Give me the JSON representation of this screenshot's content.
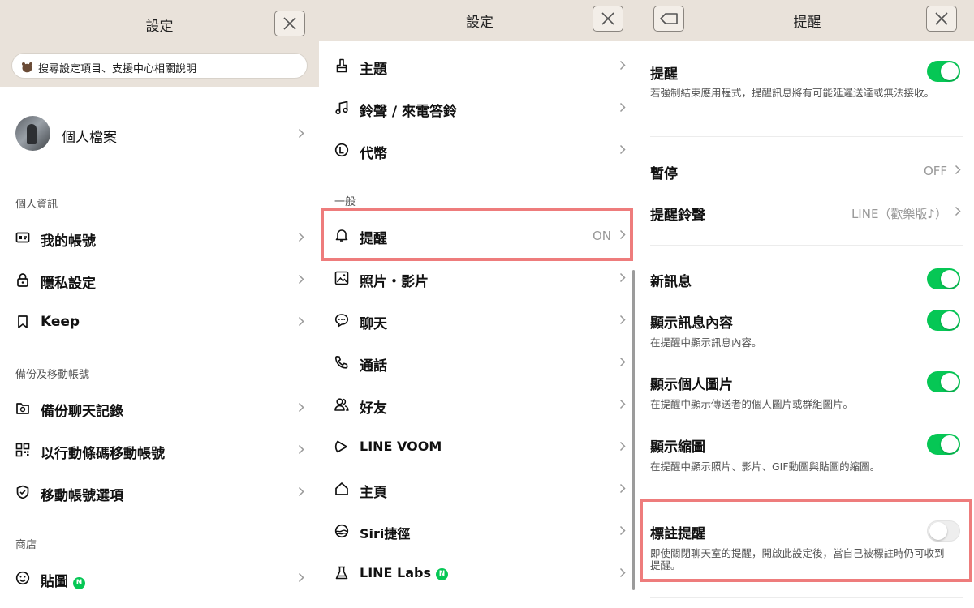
{
  "panel1": {
    "title": "設定",
    "search_placeholder": "搜尋設定項目、支援中心相關說明",
    "profile_label": "個人檔案",
    "sections": [
      {
        "header": "個人資訊",
        "items": [
          "我的帳號",
          "隱私設定",
          "Keep"
        ]
      },
      {
        "header": "備份及移動帳號",
        "items": [
          "備份聊天記錄",
          "以行動條碼移動帳號",
          "移動帳號選項"
        ]
      },
      {
        "header": "商店",
        "items": [
          "貼圖"
        ]
      }
    ],
    "new_badge": "N"
  },
  "panel2": {
    "title": "設定",
    "items_top": [
      "主題",
      "鈴聲 / 來電答鈴",
      "代幣"
    ],
    "section_header": "一般",
    "notification": {
      "label": "提醒",
      "value": "ON"
    },
    "items_bottom": [
      "照片・影片",
      "聊天",
      "通話",
      "好友",
      "LINE VOOM",
      "主頁",
      "Siri捷徑",
      "LINE Labs"
    ],
    "new_badge": "N"
  },
  "panel3": {
    "title": "提醒",
    "notifications": {
      "label": "提醒",
      "desc": "若強制結束應用程式，提醒訊息將有可能延遲送達或無法接收。",
      "on": true
    },
    "pause": {
      "label": "暫停",
      "value": "OFF"
    },
    "ringtone": {
      "label": "提醒鈴聲",
      "value": "LINE（歡樂版♪）"
    },
    "new_message": {
      "label": "新訊息",
      "on": true
    },
    "show_content": {
      "label": "顯示訊息內容",
      "desc": "在提醒中顯示訊息內容。",
      "on": true
    },
    "show_photo": {
      "label": "顯示個人圖片",
      "desc": "在提醒中顯示傳送者的個人圖片或群組圖片。",
      "on": true
    },
    "show_thumb": {
      "label": "顯示縮圖",
      "desc": "在提醒中顯示照片、影片、GIF動圖與貼圖的縮圖。",
      "on": true
    },
    "mention": {
      "label": "標註提醒",
      "desc": "即使關閉聊天室的提醒，開啟此設定後，當自己被標註時仍可收到提醒。",
      "on": false
    }
  },
  "colors": {
    "accent_green": "#06c755",
    "highlight_red": "#ee7c7c",
    "topbar": "#e9e2da"
  }
}
